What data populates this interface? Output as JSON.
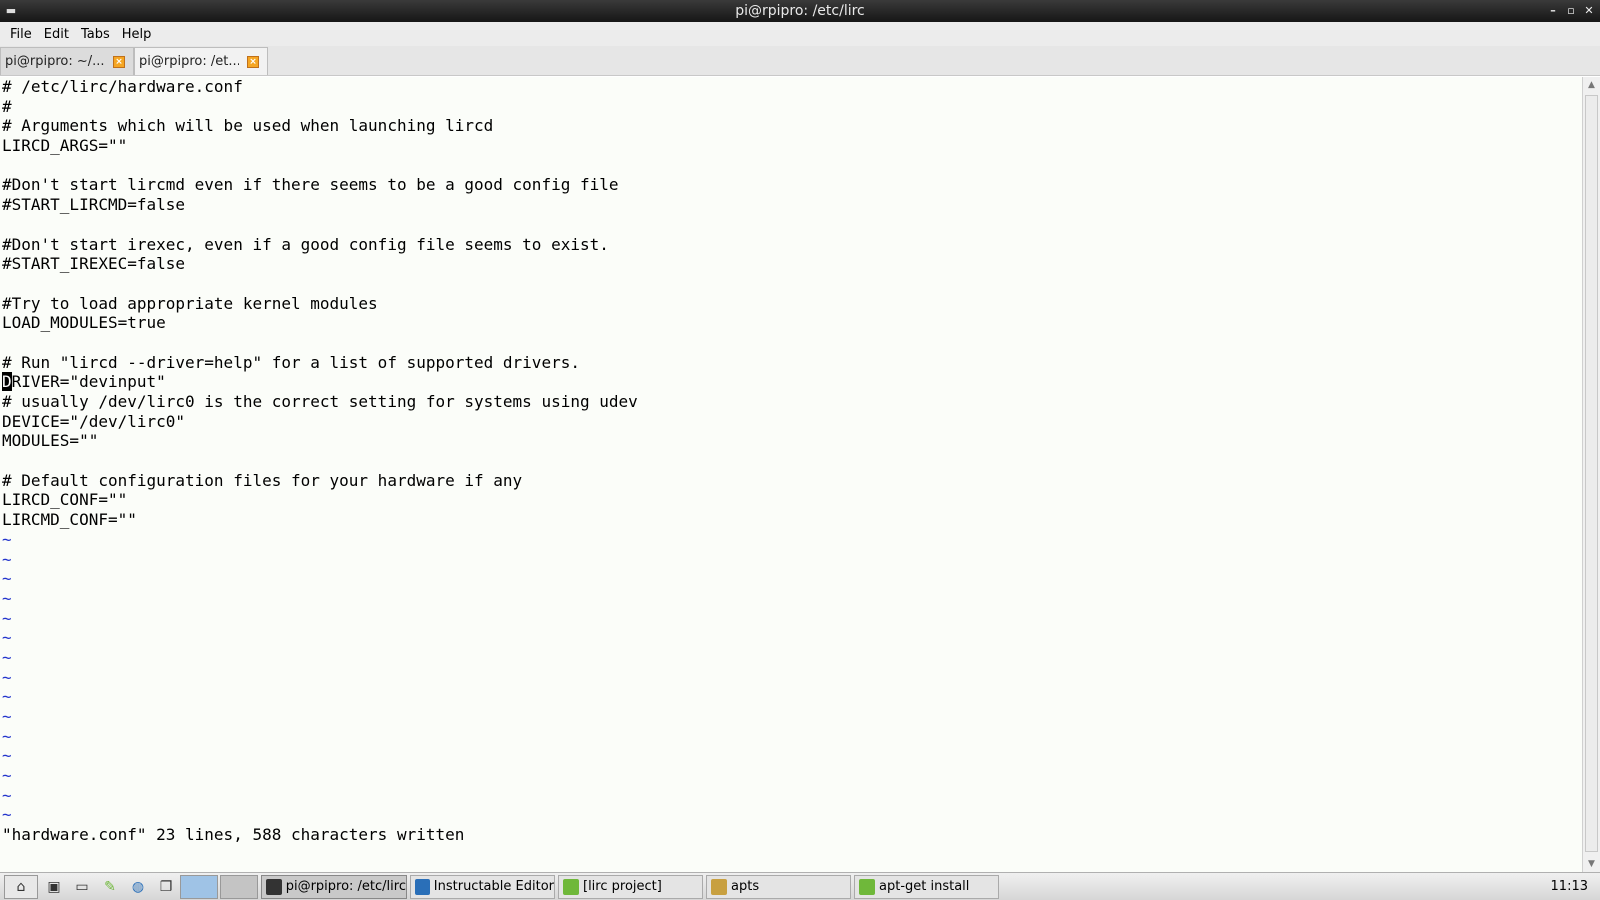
{
  "window": {
    "title": "pi@rpipro: /etc/lirc"
  },
  "menubar": {
    "items": [
      "File",
      "Edit",
      "Tabs",
      "Help"
    ]
  },
  "tabs": [
    {
      "label": "pi@rpipro: ~/..."
    },
    {
      "label": "pi@rpipro: /et..."
    }
  ],
  "terminal": {
    "lines": [
      "# /etc/lirc/hardware.conf",
      "#",
      "# Arguments which will be used when launching lircd",
      "LIRCD_ARGS=\"\"",
      "",
      "#Don't start lircmd even if there seems to be a good config file",
      "#START_LIRCMD=false",
      "",
      "#Don't start irexec, even if a good config file seems to exist.",
      "#START_IREXEC=false",
      "",
      "#Try to load appropriate kernel modules",
      "LOAD_MODULES=true",
      "",
      "# Run \"lircd --driver=help\" for a list of supported drivers.",
      "DRIVER=\"devinput\"",
      "# usually /dev/lirc0 is the correct setting for systems using udev",
      "DEVICE=\"/dev/lirc0\"",
      "MODULES=\"\"",
      "",
      "# Default configuration files for your hardware if any",
      "LIRCD_CONF=\"\"",
      "LIRCMD_CONF=\"\""
    ],
    "tilde": "~",
    "tilde_count": 15,
    "status": "\"hardware.conf\" 23 lines, 588 characters written"
  },
  "taskbar": {
    "tasks": [
      {
        "label": "pi@rpipro: /etc/lirc",
        "icon": "terminal-icon",
        "color": "#333333",
        "width": 146
      },
      {
        "label": "Instructable Editor",
        "icon": "browser-icon",
        "color": "#2a6fb8",
        "width": 145
      },
      {
        "label": "[lirc project]",
        "icon": "leafpad-icon",
        "color": "#6fb83a",
        "width": 145
      },
      {
        "label": "apts",
        "icon": "folder-icon",
        "color": "#c8a040",
        "width": 145
      },
      {
        "label": "apt-get install",
        "icon": "leafpad-icon",
        "color": "#6fb83a",
        "width": 145
      }
    ],
    "clock": "11:13"
  },
  "colors": {
    "terminal_bg": "#fbfdf9",
    "tilde": "#2233cc",
    "titlebar": "#222222"
  }
}
